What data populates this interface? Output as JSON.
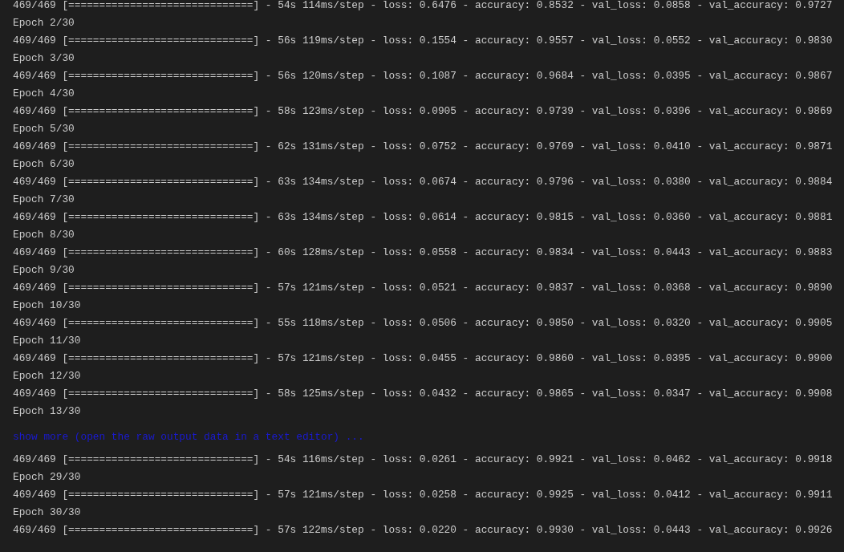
{
  "output_lines": [
    {
      "kind": "progress",
      "text": "469/469 [==============================] - 54s 114ms/step - loss: 0.6476 - accuracy: 0.8532 - val_loss: 0.0858 - val_accuracy: 0.9727"
    },
    {
      "kind": "epoch",
      "text": "Epoch 2/30"
    },
    {
      "kind": "progress",
      "text": "469/469 [==============================] - 56s 119ms/step - loss: 0.1554 - accuracy: 0.9557 - val_loss: 0.0552 - val_accuracy: 0.9830"
    },
    {
      "kind": "epoch",
      "text": "Epoch 3/30"
    },
    {
      "kind": "progress",
      "text": "469/469 [==============================] - 56s 120ms/step - loss: 0.1087 - accuracy: 0.9684 - val_loss: 0.0395 - val_accuracy: 0.9867"
    },
    {
      "kind": "epoch",
      "text": "Epoch 4/30"
    },
    {
      "kind": "progress",
      "text": "469/469 [==============================] - 58s 123ms/step - loss: 0.0905 - accuracy: 0.9739 - val_loss: 0.0396 - val_accuracy: 0.9869"
    },
    {
      "kind": "epoch",
      "text": "Epoch 5/30"
    },
    {
      "kind": "progress",
      "text": "469/469 [==============================] - 62s 131ms/step - loss: 0.0752 - accuracy: 0.9769 - val_loss: 0.0410 - val_accuracy: 0.9871"
    },
    {
      "kind": "epoch",
      "text": "Epoch 6/30"
    },
    {
      "kind": "progress",
      "text": "469/469 [==============================] - 63s 134ms/step - loss: 0.0674 - accuracy: 0.9796 - val_loss: 0.0380 - val_accuracy: 0.9884"
    },
    {
      "kind": "epoch",
      "text": "Epoch 7/30"
    },
    {
      "kind": "progress",
      "text": "469/469 [==============================] - 63s 134ms/step - loss: 0.0614 - accuracy: 0.9815 - val_loss: 0.0360 - val_accuracy: 0.9881"
    },
    {
      "kind": "epoch",
      "text": "Epoch 8/30"
    },
    {
      "kind": "progress",
      "text": "469/469 [==============================] - 60s 128ms/step - loss: 0.0558 - accuracy: 0.9834 - val_loss: 0.0443 - val_accuracy: 0.9883"
    },
    {
      "kind": "epoch",
      "text": "Epoch 9/30"
    },
    {
      "kind": "progress",
      "text": "469/469 [==============================] - 57s 121ms/step - loss: 0.0521 - accuracy: 0.9837 - val_loss: 0.0368 - val_accuracy: 0.9890"
    },
    {
      "kind": "epoch",
      "text": "Epoch 10/30"
    },
    {
      "kind": "progress",
      "text": "469/469 [==============================] - 55s 118ms/step - loss: 0.0506 - accuracy: 0.9850 - val_loss: 0.0320 - val_accuracy: 0.9905"
    },
    {
      "kind": "epoch",
      "text": "Epoch 11/30"
    },
    {
      "kind": "progress",
      "text": "469/469 [==============================] - 57s 121ms/step - loss: 0.0455 - accuracy: 0.9860 - val_loss: 0.0395 - val_accuracy: 0.9900"
    },
    {
      "kind": "epoch",
      "text": "Epoch 12/30"
    },
    {
      "kind": "progress",
      "text": "469/469 [==============================] - 58s 125ms/step - loss: 0.0432 - accuracy: 0.9865 - val_loss: 0.0347 - val_accuracy: 0.9908"
    },
    {
      "kind": "epoch",
      "text": "Epoch 13/30"
    },
    {
      "kind": "link",
      "text": "show more (open the raw output data in a text editor) ..."
    },
    {
      "kind": "progress",
      "text": "469/469 [==============================] - 54s 116ms/step - loss: 0.0261 - accuracy: 0.9921 - val_loss: 0.0462 - val_accuracy: 0.9918"
    },
    {
      "kind": "epoch",
      "text": "Epoch 29/30"
    },
    {
      "kind": "progress",
      "text": "469/469 [==============================] - 57s 121ms/step - loss: 0.0258 - accuracy: 0.9925 - val_loss: 0.0412 - val_accuracy: 0.9911"
    },
    {
      "kind": "epoch",
      "text": "Epoch 30/30"
    },
    {
      "kind": "progress",
      "text": "469/469 [==============================] - 57s 122ms/step - loss: 0.0220 - accuracy: 0.9930 - val_loss: 0.0443 - val_accuracy: 0.9926"
    }
  ]
}
